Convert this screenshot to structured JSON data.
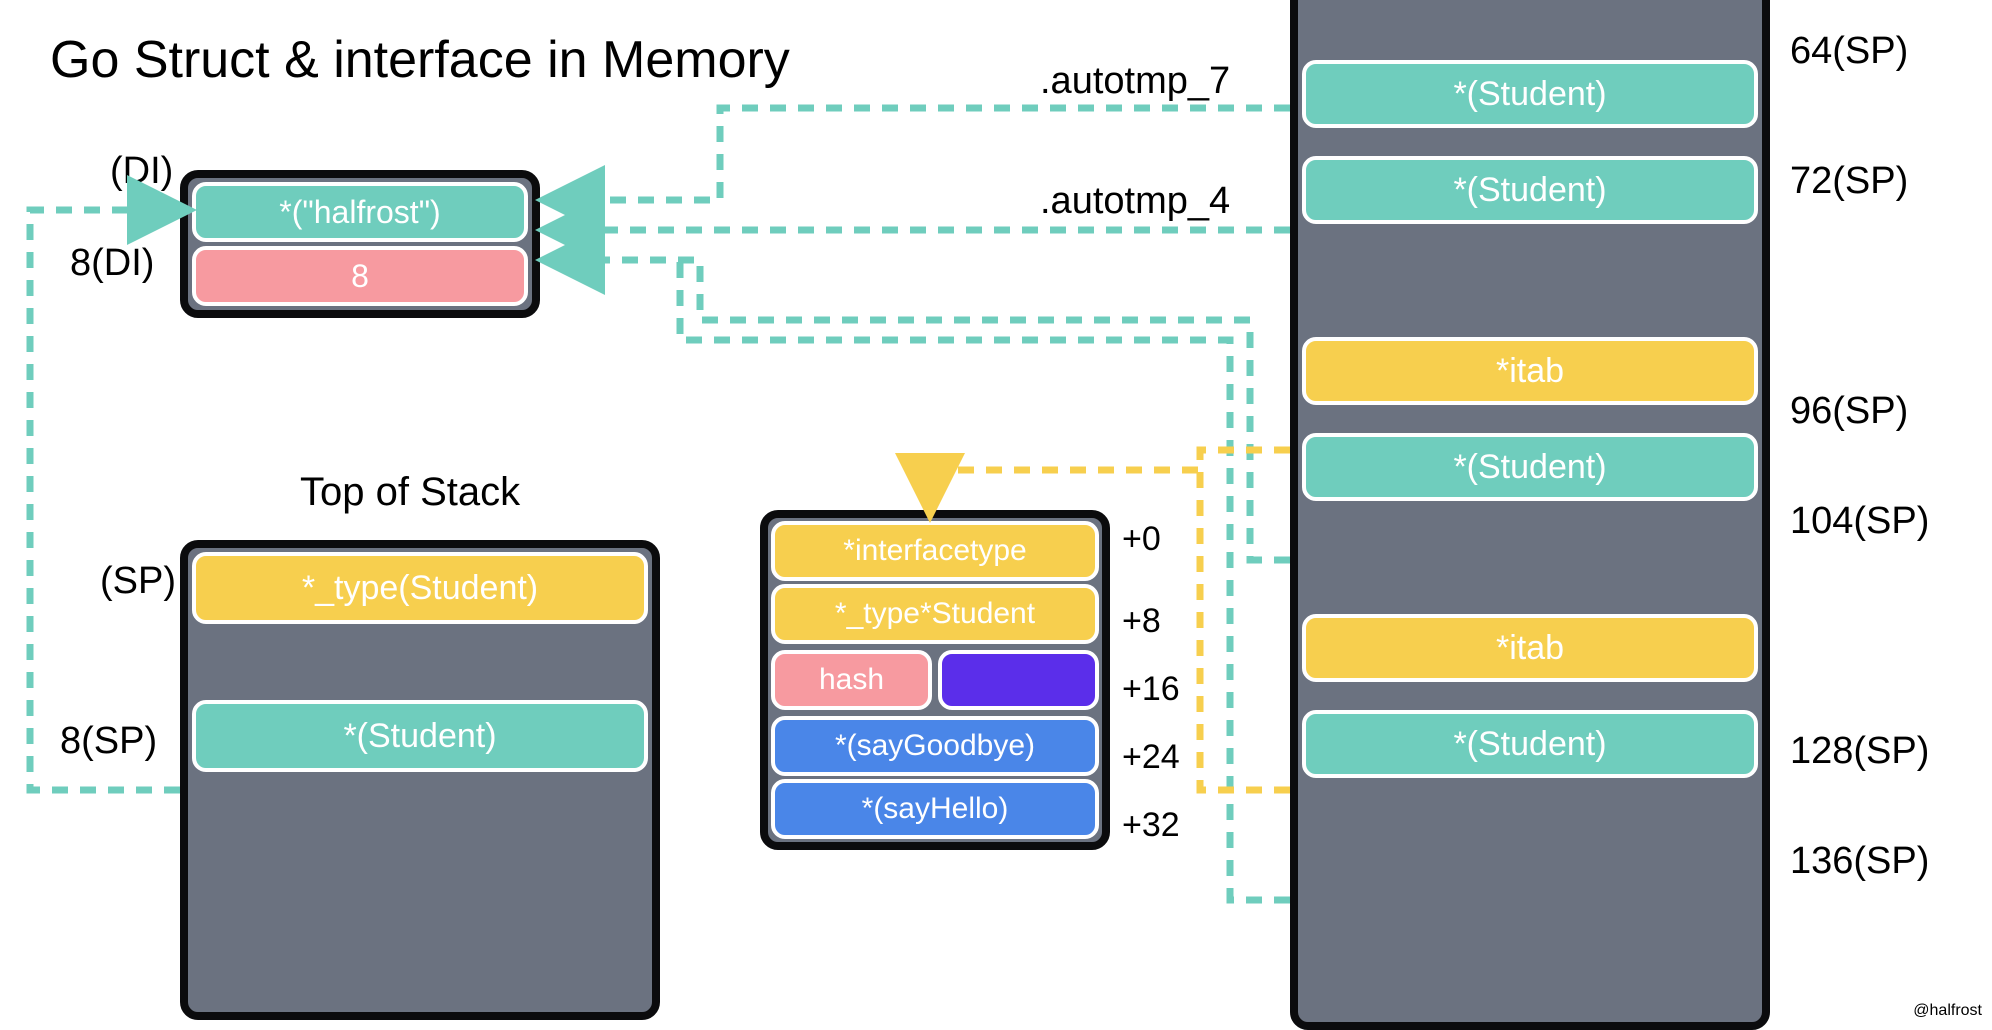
{
  "title": "Go Struct & interface in Memory",
  "watermark": "@halfrost",
  "di": {
    "label_di": "(DI)",
    "label_8di": "8(DI)",
    "cell0": "*(\"halfrost\")",
    "cell1": "8"
  },
  "tos": {
    "heading": "Top of Stack",
    "label_sp": "(SP)",
    "label_8sp": "8(SP)",
    "cell0": "*_type(Student)",
    "cell1": "*(Student)"
  },
  "itab": {
    "offsets": {
      "o0": "+0",
      "o8": "+8",
      "o16": "+16",
      "o24": "+24",
      "o32": "+32"
    },
    "cell0": "*interfacetype",
    "cell1": "*_type*Student",
    "cell2a": "hash",
    "cell2b": "",
    "cell3": "*(sayGoodbye)",
    "cell4": "*(sayHello)"
  },
  "right": {
    "labels": {
      "autotmp7": ".autotmp_7",
      "autotmp4": ".autotmp_4",
      "sp64": "64(SP)",
      "sp72": "72(SP)",
      "sp96": "96(SP)",
      "sp104": "104(SP)",
      "sp128": "128(SP)",
      "sp136": "136(SP)"
    },
    "cells": {
      "c64": "*(Student)",
      "c72": "*(Student)",
      "c96": "*itab",
      "c104": "*(Student)",
      "c128": "*itab",
      "c136": "*(Student)"
    }
  }
}
